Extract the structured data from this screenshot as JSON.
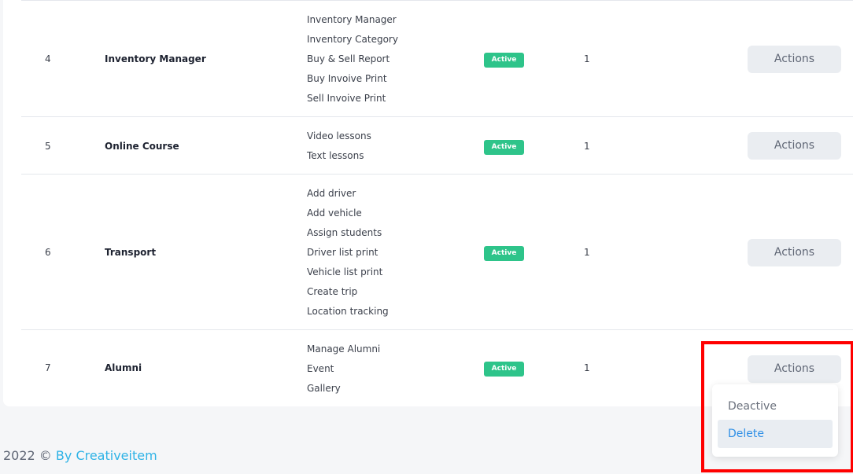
{
  "table": {
    "rows": [
      {
        "id": "4",
        "name": "Inventory Manager",
        "features": [
          "Inventory Manager",
          "Inventory Category",
          "Buy & Sell Report",
          "Buy Invoive Print",
          "Sell Invoive Print"
        ],
        "status": "Active",
        "count": "1",
        "action_label": "Actions"
      },
      {
        "id": "5",
        "name": "Online Course",
        "features": [
          "Video lessons",
          "Text lessons"
        ],
        "status": "Active",
        "count": "1",
        "action_label": "Actions"
      },
      {
        "id": "6",
        "name": "Transport",
        "features": [
          "Add driver",
          "Add vehicle",
          "Assign students",
          "Driver list print",
          "Vehicle list print",
          "Create trip",
          "Location tracking"
        ],
        "status": "Active",
        "count": "1",
        "action_label": "Actions"
      },
      {
        "id": "7",
        "name": "Alumni",
        "features": [
          "Manage Alumni",
          "Event",
          "Gallery"
        ],
        "status": "Active",
        "count": "1",
        "action_label": "Actions"
      }
    ]
  },
  "dropdown": {
    "items": [
      "Deactive",
      "Delete"
    ]
  },
  "footer": {
    "prefix": "2022 ©",
    "link": "By Creativeitem"
  },
  "colors": {
    "active_badge": "#2ec48a",
    "link": "#2fb3e6",
    "delete": "#2f8fe6",
    "highlight": "#ff0000"
  }
}
